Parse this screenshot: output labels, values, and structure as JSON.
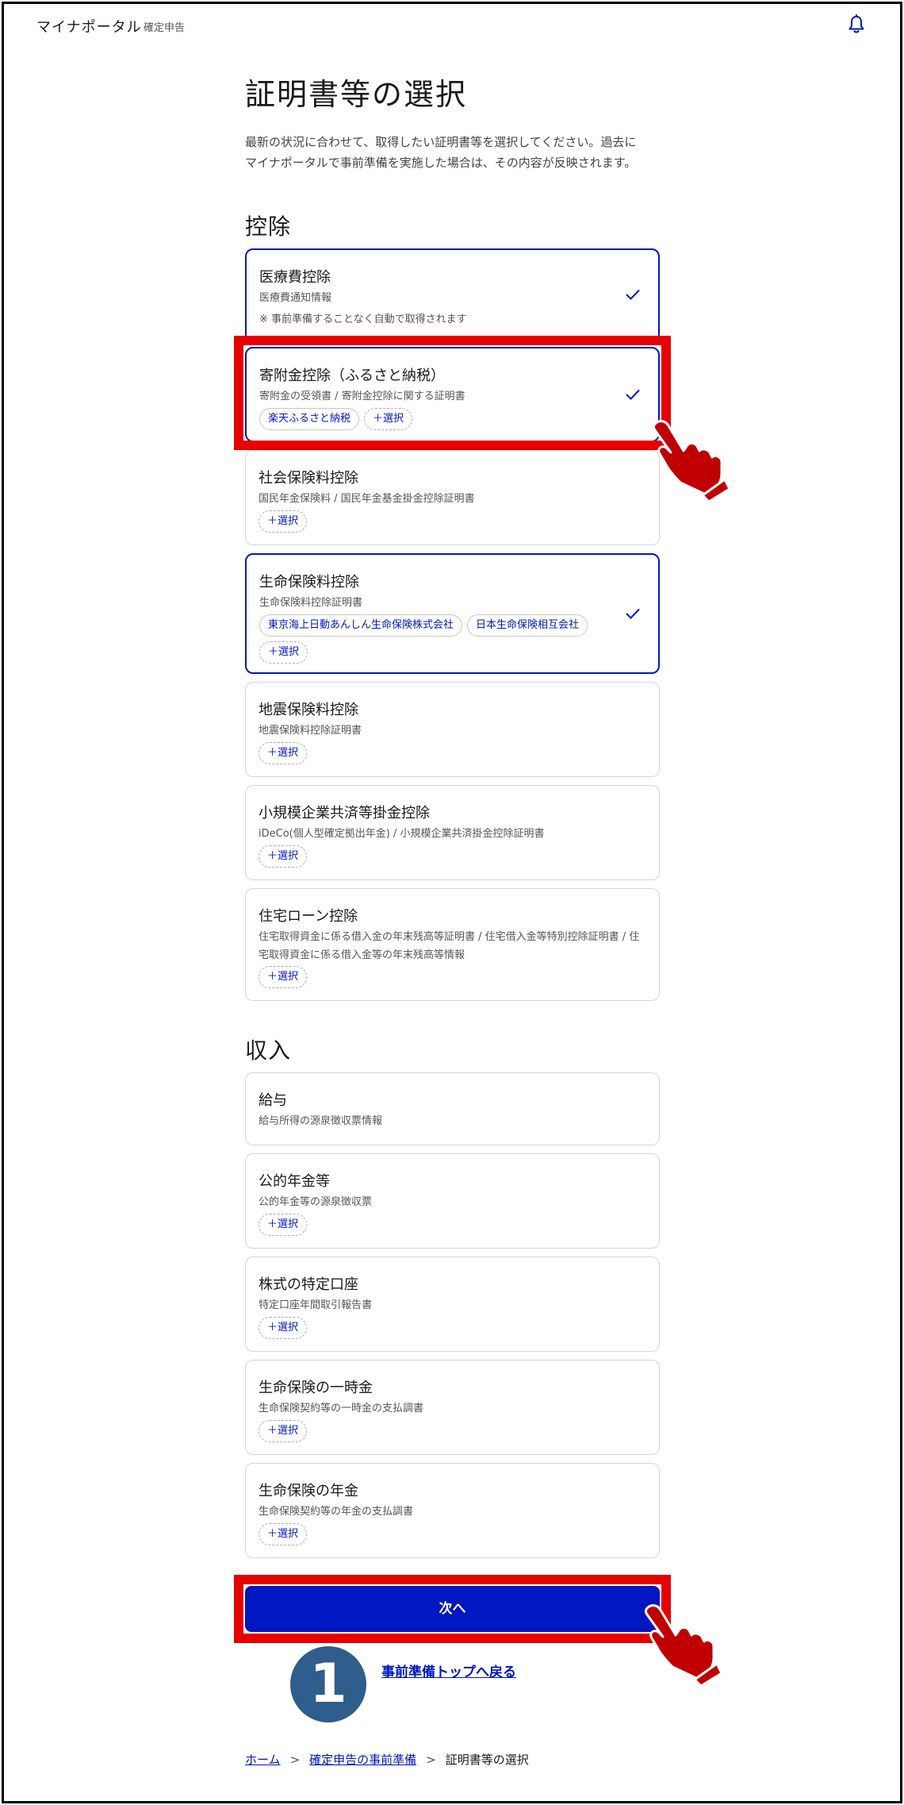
{
  "header": {
    "brand": "マイナポータル",
    "brand_sub": "確定申告",
    "bell_icon": "bell-icon"
  },
  "page": {
    "title": "証明書等の選択",
    "intro_line1": "最新の状況に合わせて、取得したい証明書等を選択してください。過去に",
    "intro_line2": "マイナポータルで事前準備を実施した場合は、その内容が反映されます。"
  },
  "deductions": {
    "heading": "控除",
    "items": [
      {
        "title": "医療費控除",
        "desc": "医療費通知情報",
        "note": "※ 事前準備することなく自動で取得されます",
        "selected": true
      },
      {
        "title": "寄附金控除（ふるさと納税）",
        "desc": "寄附金の受領書 / 寄附金控除に関する証明書",
        "chip1": "楽天ふるさと納税",
        "add": "＋選択",
        "selected": true
      },
      {
        "title": "社会保険料控除",
        "desc": "国民年金保険料 / 国民年金基金掛金控除証明書",
        "add": "＋選択",
        "selected": false
      },
      {
        "title": "生命保険料控除",
        "desc": "生命保険料控除証明書",
        "chip1": "東京海上日動あんしん生命保険株式会社",
        "chip2": "日本生命保険相互会社",
        "add": "＋選択",
        "selected": true
      },
      {
        "title": "地震保険料控除",
        "desc": "地震保険料控除証明書",
        "add": "＋選択",
        "selected": false
      },
      {
        "title": "小規模企業共済等掛金控除",
        "desc": "iDeCo(個人型確定拠出年金) / 小規模企業共済掛金控除証明書",
        "add": "＋選択",
        "selected": false
      },
      {
        "title": "住宅ローン控除",
        "desc_line1": "住宅取得資金に係る借入金の年末残高等証明書 / 住宅借入金等特別控除証明書 / 住",
        "desc_line2": "宅取得資金に係る借入金等の年末残高等情報",
        "add": "＋選択",
        "selected": false
      }
    ]
  },
  "income": {
    "heading": "収入",
    "items": [
      {
        "title": "給与",
        "desc": "給与所得の源泉徴収票情報"
      },
      {
        "title": "公的年金等",
        "desc": "公的年金等の源泉徴収票",
        "add": "＋選択"
      },
      {
        "title": "株式の特定口座",
        "desc": "特定口座年間取引報告書",
        "add": "＋選択"
      },
      {
        "title": "生命保険の一時金",
        "desc": "生命保険契約等の一時金の支払調書",
        "add": "＋選択"
      },
      {
        "title": "生命保険の年金",
        "desc": "生命保険契約等の年金の支払調書",
        "add": "＋選択"
      }
    ]
  },
  "actions": {
    "next": "次へ",
    "back": "事前準備トップへ戻る",
    "step_number": "1"
  },
  "breadcrumb": {
    "home": "ホーム",
    "parent": "確定申告の事前準備",
    "current": "証明書等の選択",
    "sep": ">"
  },
  "colors": {
    "accent": "#0017c1",
    "highlight": "#e60000",
    "hand": "#c00000",
    "badge": "#2f5d8c"
  }
}
